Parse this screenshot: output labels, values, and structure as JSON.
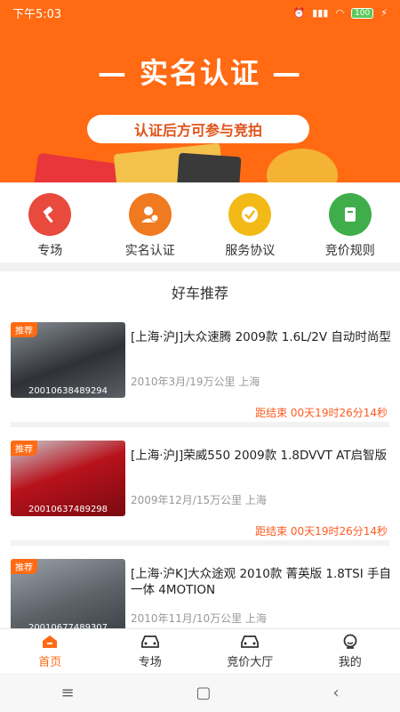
{
  "status": {
    "time": "下午5:03",
    "battery": "100"
  },
  "banner": {
    "title": "— 实名认证 —",
    "subtitle": "认证后方可参与竞拍"
  },
  "quick": [
    {
      "label": "专场"
    },
    {
      "label": "实名认证"
    },
    {
      "label": "服务协议"
    },
    {
      "label": "竞价规则"
    }
  ],
  "section": {
    "title": "好车推荐"
  },
  "cars": [
    {
      "tag": "推荐",
      "code": "20010638489294",
      "title": "[上海·沪J]大众速腾 2009款 1.6L/2V 自动时尚型",
      "meta": "2010年3月/19万公里 上海",
      "countdown": "距结束 00天19时26分14秒"
    },
    {
      "tag": "推荐",
      "code": "20010637489298",
      "title": "[上海·沪J]荣威550 2009款 1.8DVVT AT启智版",
      "meta": "2009年12月/15万公里 上海",
      "countdown": "距结束 00天19时26分14秒"
    },
    {
      "tag": "推荐",
      "code": "20010677489307",
      "title": "[上海·沪K]大众途观 2010款 菁英版 1.8TSI 手自一体 4MOTION",
      "meta": "2010年11月/10万公里 上海",
      "countdown": ""
    }
  ],
  "tabs": [
    {
      "label": "首页"
    },
    {
      "label": "专场"
    },
    {
      "label": "竞价大厅"
    },
    {
      "label": "我的"
    }
  ],
  "colors": {
    "accent": "#ff6a13"
  }
}
